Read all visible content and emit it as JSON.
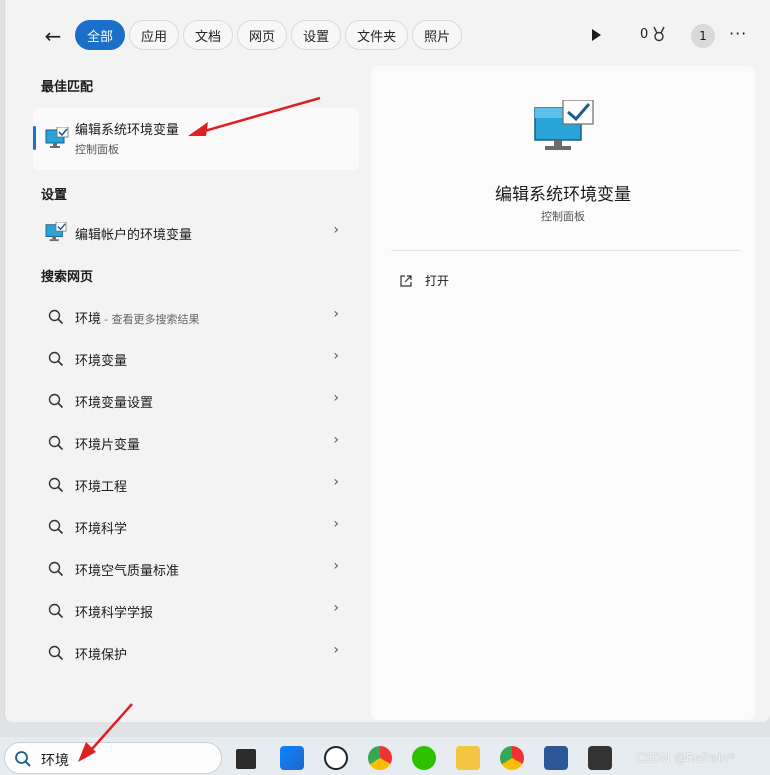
{
  "tabs": [
    "全部",
    "应用",
    "文档",
    "网页",
    "设置",
    "文件夹",
    "照片"
  ],
  "header": {
    "points": "0",
    "avatar_text": "1"
  },
  "sections": {
    "best": "最佳匹配",
    "settings": "设置",
    "web": "搜索网页"
  },
  "best_match": {
    "title": "编辑系统环境变量",
    "subtitle": "控制面板"
  },
  "settings_item": {
    "label": "编辑帐户的环境变量"
  },
  "web_items": [
    {
      "label": "环境",
      "suffix": "- 查看更多搜索结果"
    },
    {
      "label": "环境变量"
    },
    {
      "label": "环境变量设置"
    },
    {
      "label": "环境片变量"
    },
    {
      "label": "环境工程"
    },
    {
      "label": "环境科学"
    },
    {
      "label": "环境空气质量标准"
    },
    {
      "label": "环境科学学报"
    },
    {
      "label": "环境保护"
    }
  ],
  "preview": {
    "title": "编辑系统环境变量",
    "subtitle": "控制面板",
    "open_label": "打开"
  },
  "search": {
    "query": "环境"
  },
  "watermark": "CSDN @Refrain*",
  "colors": {
    "accent": "#1a6fc9",
    "arrow": "#e02020"
  }
}
